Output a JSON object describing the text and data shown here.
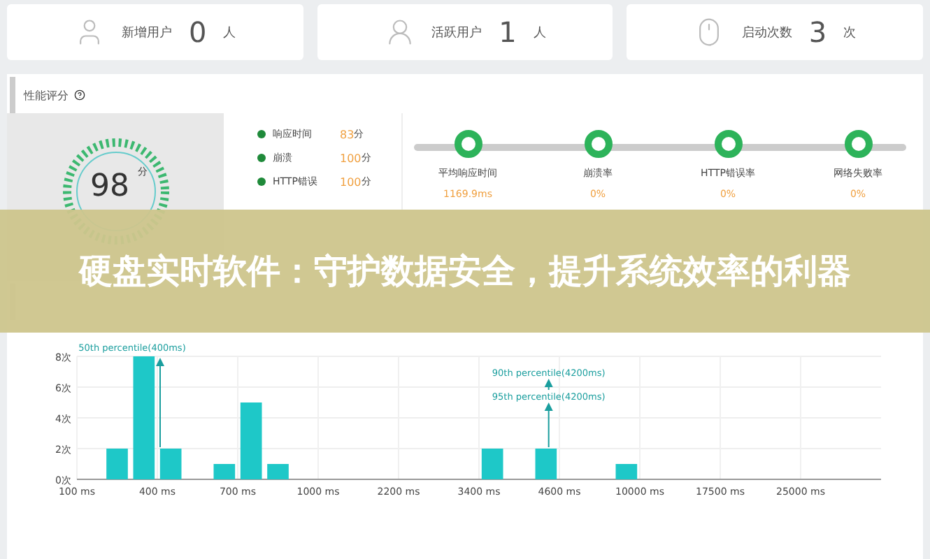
{
  "stats": [
    {
      "kind": "user",
      "label": "新增用户",
      "value": "0",
      "unit": "人"
    },
    {
      "kind": "active",
      "label": "活跃用户",
      "value": "1",
      "unit": "人"
    },
    {
      "kind": "launch",
      "label": "启动次数",
      "value": "3",
      "unit": "次"
    }
  ],
  "performance": {
    "title": "性能评分",
    "score": {
      "value": "98",
      "unit": "分"
    },
    "metrics": [
      {
        "name": "响应时间",
        "score": "83",
        "unit": "分"
      },
      {
        "name": "崩溃",
        "score": "100",
        "unit": "分"
      },
      {
        "name": "HTTP错误",
        "score": "100",
        "unit": "分"
      }
    ],
    "timeline": [
      {
        "label": "平均响应时间",
        "value": "1169.9ms"
      },
      {
        "label": "崩溃率",
        "value": "0%"
      },
      {
        "label": "HTTP错误率",
        "value": "0%"
      },
      {
        "label": "网络失败率",
        "value": "0%"
      }
    ]
  },
  "distribution": {
    "chart_data": {
      "type": "bar",
      "categories": [
        "100 ms",
        null,
        null,
        "400 ms",
        null,
        null,
        "700 ms",
        null,
        null,
        "1000 ms",
        null,
        null,
        "2200 ms",
        null,
        null,
        "3400 ms",
        null,
        null,
        "4600 ms",
        null,
        null,
        "10000 ms",
        null,
        null,
        "17500 ms",
        null,
        null,
        "25000 ms",
        null,
        null
      ],
      "values": [
        null,
        2,
        8,
        2,
        null,
        1,
        5,
        1,
        null,
        null,
        null,
        null,
        null,
        null,
        null,
        2,
        null,
        2,
        null,
        null,
        1,
        null,
        null,
        null,
        null,
        null,
        null,
        null,
        null,
        null
      ],
      "ylim": [
        0,
        8
      ],
      "grid": true,
      "yticks": [
        {
          "value": 0,
          "label": "0次"
        },
        {
          "value": 2,
          "label": "2次"
        },
        {
          "value": 4,
          "label": "4次"
        },
        {
          "value": 6,
          "label": "6次"
        },
        {
          "value": 8,
          "label": "8次"
        }
      ],
      "annotations": [
        "50th percentile(400ms)",
        "90th percentile(4200ms)",
        "95th percentile(4200ms)"
      ]
    }
  },
  "banner": {
    "title": "硬盘实时软件：守护数据安全，提升系统效率的利器"
  }
}
